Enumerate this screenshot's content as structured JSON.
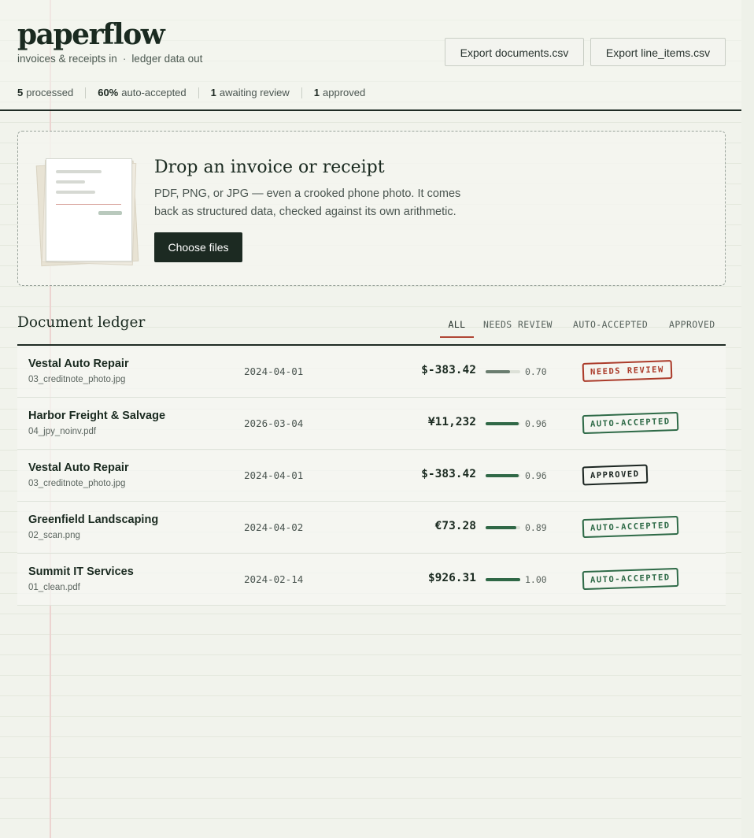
{
  "app": {
    "logo": "paperflow",
    "tagline_left": "invoices & receipts in",
    "tagline_sep": "·",
    "tagline_right": "ledger data out"
  },
  "exports": {
    "documents_label": "Export documents.csv",
    "line_items_label": "Export line_items.csv"
  },
  "stats": {
    "processed_count": "5",
    "processed_label": "processed",
    "auto_pct": "60%",
    "auto_label": "auto-accepted",
    "review_count": "1",
    "review_label": "awaiting review",
    "approved_count": "1",
    "approved_label": "approved"
  },
  "dropzone": {
    "title": "Drop an invoice or receipt",
    "description": "PDF, PNG, or JPG — even a crooked phone photo. It comes back as structured data, checked against its own arithmetic.",
    "button_label": "Choose files"
  },
  "ledger": {
    "title": "Document ledger",
    "tabs": [
      {
        "label": "ALL",
        "active": true
      },
      {
        "label": "NEEDS REVIEW",
        "active": false
      },
      {
        "label": "AUTO-ACCEPTED",
        "active": false
      },
      {
        "label": "APPROVED",
        "active": false
      }
    ],
    "rows": [
      {
        "vendor": "Vestal Auto Repair",
        "file": "03_creditnote_photo.jpg",
        "date": "2024-04-01",
        "amount": "$-383.42",
        "confidence": 0.7,
        "confidence_label": "0.70",
        "status": "NEEDS REVIEW",
        "status_kind": "review"
      },
      {
        "vendor": "Harbor Freight & Salvage",
        "file": "04_jpy_noinv.pdf",
        "date": "2026-03-04",
        "amount": "¥11,232",
        "confidence": 0.96,
        "confidence_label": "0.96",
        "status": "AUTO-ACCEPTED",
        "status_kind": "auto"
      },
      {
        "vendor": "Vestal Auto Repair",
        "file": "03_creditnote_photo.jpg",
        "date": "2024-04-01",
        "amount": "$-383.42",
        "confidence": 0.96,
        "confidence_label": "0.96",
        "status": "APPROVED",
        "status_kind": "approved"
      },
      {
        "vendor": "Greenfield Landscaping",
        "file": "02_scan.png",
        "date": "2024-04-02",
        "amount": "€73.28",
        "confidence": 0.89,
        "confidence_label": "0.89",
        "status": "AUTO-ACCEPTED",
        "status_kind": "auto"
      },
      {
        "vendor": "Summit IT Services",
        "file": "01_clean.pdf",
        "date": "2024-02-14",
        "amount": "$926.31",
        "confidence": 1.0,
        "confidence_label": "1.00",
        "status": "AUTO-ACCEPTED",
        "status_kind": "auto"
      }
    ]
  },
  "colors": {
    "accent_dark": "#1c2a22",
    "review_red": "#ab3b2a",
    "accepted_green": "#2e6a47",
    "margin_pink": "#ecd3d0"
  }
}
